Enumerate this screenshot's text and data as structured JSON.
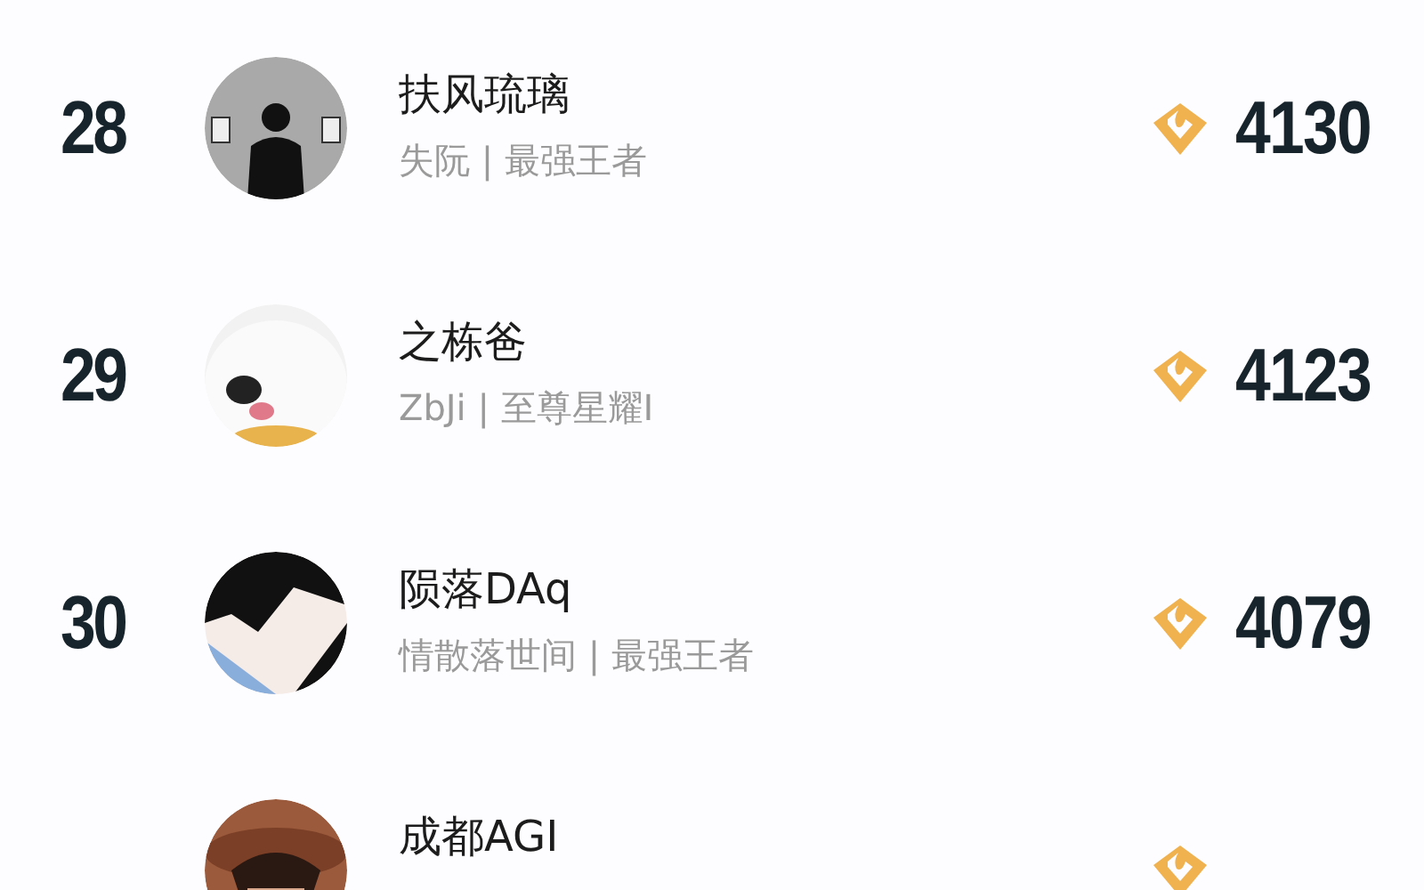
{
  "players": [
    {
      "rank": "28",
      "name": "扶风琉璃",
      "subtitle": "失阮 | 最强王者",
      "score": "4130"
    },
    {
      "rank": "29",
      "name": "之栋爸",
      "subtitle": "ZbJi | 至尊星耀I",
      "score": "4123"
    },
    {
      "rank": "30",
      "name": "陨落DAq",
      "subtitle": "情散落世间 | 最强王者",
      "score": "4079"
    },
    {
      "name": "成都AGI"
    }
  ]
}
